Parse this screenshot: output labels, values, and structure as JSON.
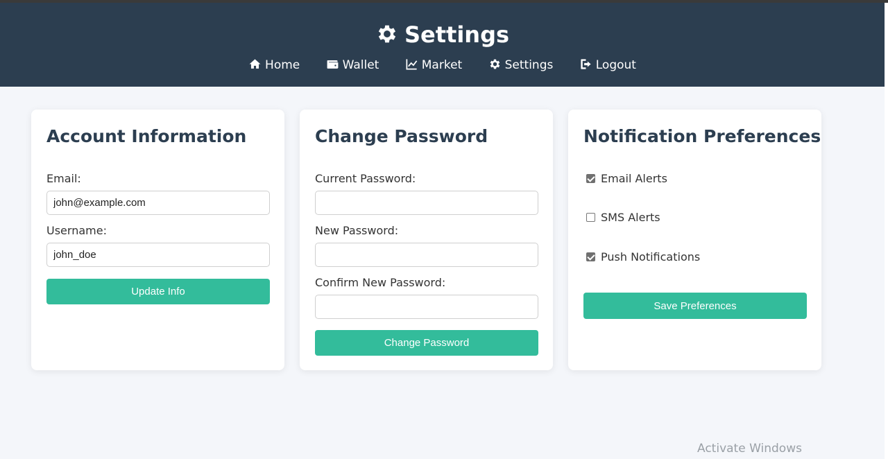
{
  "header": {
    "title": "Settings",
    "title_icon": "gear-icon",
    "nav": [
      {
        "label": "Home",
        "icon": "home-icon"
      },
      {
        "label": "Wallet",
        "icon": "wallet-icon"
      },
      {
        "label": "Market",
        "icon": "chart-line-icon"
      },
      {
        "label": "Settings",
        "icon": "gear-icon"
      },
      {
        "label": "Logout",
        "icon": "logout-icon"
      }
    ]
  },
  "account": {
    "title": "Account Information",
    "email_label": "Email:",
    "email_value": "john@example.com",
    "username_label": "Username:",
    "username_value": "john_doe",
    "button": "Update Info"
  },
  "password": {
    "title": "Change Password",
    "current_label": "Current Password:",
    "new_label": "New Password:",
    "confirm_label": "Confirm New Password:",
    "current_value": "",
    "new_value": "",
    "confirm_value": "",
    "button": "Change Password"
  },
  "notifications": {
    "title": "Notification Preferences",
    "options": [
      {
        "label": "Email Alerts",
        "checked": true
      },
      {
        "label": "SMS Alerts",
        "checked": false
      },
      {
        "label": "Push Notifications",
        "checked": true
      }
    ],
    "button": "Save Preferences"
  },
  "watermark": "Activate Windows",
  "colors": {
    "header_bg": "#2c3e50",
    "accent": "#33bc9b",
    "page_bg": "#f4f6fa"
  }
}
